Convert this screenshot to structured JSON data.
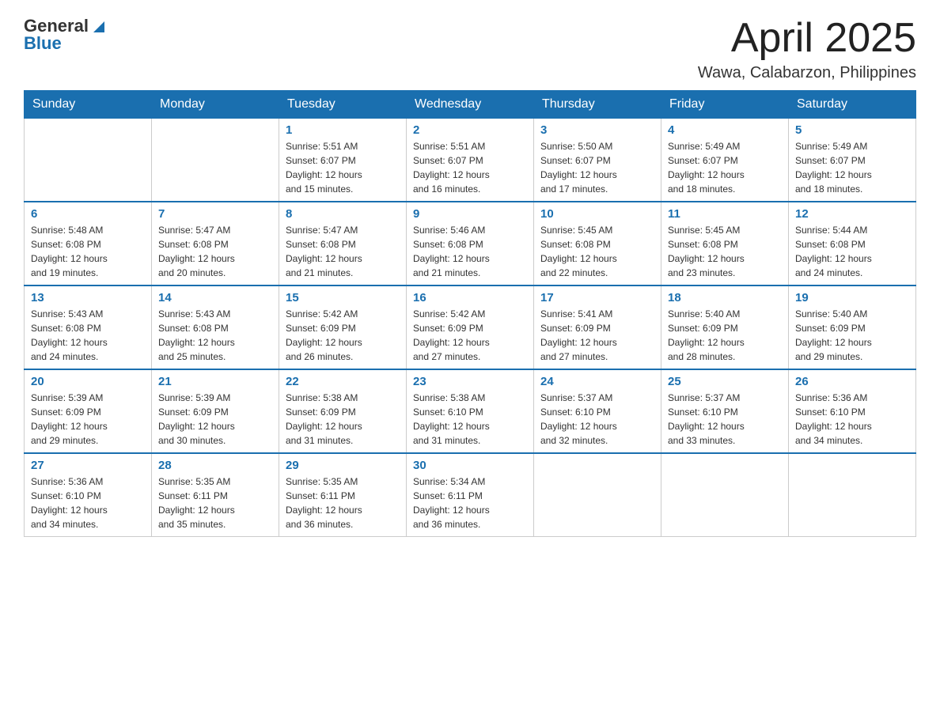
{
  "header": {
    "logo": {
      "general": "General",
      "blue": "Blue"
    },
    "title": "April 2025",
    "subtitle": "Wawa, Calabarzon, Philippines"
  },
  "calendar": {
    "days_of_week": [
      "Sunday",
      "Monday",
      "Tuesday",
      "Wednesday",
      "Thursday",
      "Friday",
      "Saturday"
    ],
    "weeks": [
      [
        {
          "day": "",
          "info": ""
        },
        {
          "day": "",
          "info": ""
        },
        {
          "day": "1",
          "info": "Sunrise: 5:51 AM\nSunset: 6:07 PM\nDaylight: 12 hours\nand 15 minutes."
        },
        {
          "day": "2",
          "info": "Sunrise: 5:51 AM\nSunset: 6:07 PM\nDaylight: 12 hours\nand 16 minutes."
        },
        {
          "day": "3",
          "info": "Sunrise: 5:50 AM\nSunset: 6:07 PM\nDaylight: 12 hours\nand 17 minutes."
        },
        {
          "day": "4",
          "info": "Sunrise: 5:49 AM\nSunset: 6:07 PM\nDaylight: 12 hours\nand 18 minutes."
        },
        {
          "day": "5",
          "info": "Sunrise: 5:49 AM\nSunset: 6:07 PM\nDaylight: 12 hours\nand 18 minutes."
        }
      ],
      [
        {
          "day": "6",
          "info": "Sunrise: 5:48 AM\nSunset: 6:08 PM\nDaylight: 12 hours\nand 19 minutes."
        },
        {
          "day": "7",
          "info": "Sunrise: 5:47 AM\nSunset: 6:08 PM\nDaylight: 12 hours\nand 20 minutes."
        },
        {
          "day": "8",
          "info": "Sunrise: 5:47 AM\nSunset: 6:08 PM\nDaylight: 12 hours\nand 21 minutes."
        },
        {
          "day": "9",
          "info": "Sunrise: 5:46 AM\nSunset: 6:08 PM\nDaylight: 12 hours\nand 21 minutes."
        },
        {
          "day": "10",
          "info": "Sunrise: 5:45 AM\nSunset: 6:08 PM\nDaylight: 12 hours\nand 22 minutes."
        },
        {
          "day": "11",
          "info": "Sunrise: 5:45 AM\nSunset: 6:08 PM\nDaylight: 12 hours\nand 23 minutes."
        },
        {
          "day": "12",
          "info": "Sunrise: 5:44 AM\nSunset: 6:08 PM\nDaylight: 12 hours\nand 24 minutes."
        }
      ],
      [
        {
          "day": "13",
          "info": "Sunrise: 5:43 AM\nSunset: 6:08 PM\nDaylight: 12 hours\nand 24 minutes."
        },
        {
          "day": "14",
          "info": "Sunrise: 5:43 AM\nSunset: 6:08 PM\nDaylight: 12 hours\nand 25 minutes."
        },
        {
          "day": "15",
          "info": "Sunrise: 5:42 AM\nSunset: 6:09 PM\nDaylight: 12 hours\nand 26 minutes."
        },
        {
          "day": "16",
          "info": "Sunrise: 5:42 AM\nSunset: 6:09 PM\nDaylight: 12 hours\nand 27 minutes."
        },
        {
          "day": "17",
          "info": "Sunrise: 5:41 AM\nSunset: 6:09 PM\nDaylight: 12 hours\nand 27 minutes."
        },
        {
          "day": "18",
          "info": "Sunrise: 5:40 AM\nSunset: 6:09 PM\nDaylight: 12 hours\nand 28 minutes."
        },
        {
          "day": "19",
          "info": "Sunrise: 5:40 AM\nSunset: 6:09 PM\nDaylight: 12 hours\nand 29 minutes."
        }
      ],
      [
        {
          "day": "20",
          "info": "Sunrise: 5:39 AM\nSunset: 6:09 PM\nDaylight: 12 hours\nand 29 minutes."
        },
        {
          "day": "21",
          "info": "Sunrise: 5:39 AM\nSunset: 6:09 PM\nDaylight: 12 hours\nand 30 minutes."
        },
        {
          "day": "22",
          "info": "Sunrise: 5:38 AM\nSunset: 6:09 PM\nDaylight: 12 hours\nand 31 minutes."
        },
        {
          "day": "23",
          "info": "Sunrise: 5:38 AM\nSunset: 6:10 PM\nDaylight: 12 hours\nand 31 minutes."
        },
        {
          "day": "24",
          "info": "Sunrise: 5:37 AM\nSunset: 6:10 PM\nDaylight: 12 hours\nand 32 minutes."
        },
        {
          "day": "25",
          "info": "Sunrise: 5:37 AM\nSunset: 6:10 PM\nDaylight: 12 hours\nand 33 minutes."
        },
        {
          "day": "26",
          "info": "Sunrise: 5:36 AM\nSunset: 6:10 PM\nDaylight: 12 hours\nand 34 minutes."
        }
      ],
      [
        {
          "day": "27",
          "info": "Sunrise: 5:36 AM\nSunset: 6:10 PM\nDaylight: 12 hours\nand 34 minutes."
        },
        {
          "day": "28",
          "info": "Sunrise: 5:35 AM\nSunset: 6:11 PM\nDaylight: 12 hours\nand 35 minutes."
        },
        {
          "day": "29",
          "info": "Sunrise: 5:35 AM\nSunset: 6:11 PM\nDaylight: 12 hours\nand 36 minutes."
        },
        {
          "day": "30",
          "info": "Sunrise: 5:34 AM\nSunset: 6:11 PM\nDaylight: 12 hours\nand 36 minutes."
        },
        {
          "day": "",
          "info": ""
        },
        {
          "day": "",
          "info": ""
        },
        {
          "day": "",
          "info": ""
        }
      ]
    ]
  }
}
